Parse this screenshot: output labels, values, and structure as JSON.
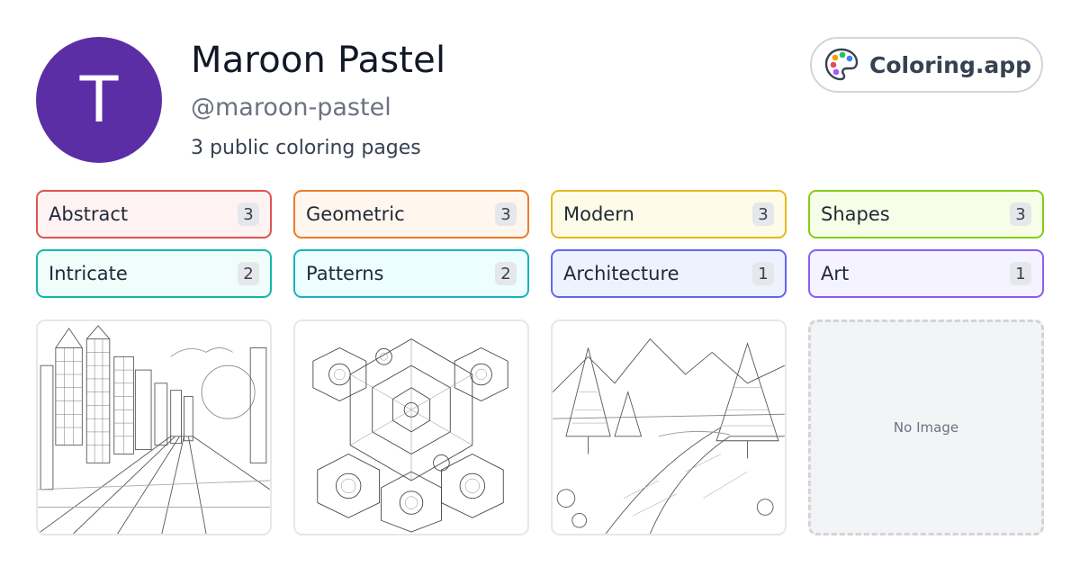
{
  "profile": {
    "avatar_letter": "T",
    "avatar_color": "#5b2ea6",
    "name": "Maroon Pastel",
    "handle": "@maroon-pastel",
    "page_count_text": "3 public coloring pages"
  },
  "brand": {
    "label": "Coloring.app",
    "icon": "palette-icon"
  },
  "tags": [
    {
      "label": "Abstract",
      "count": "3",
      "border": "#e05252",
      "bg": "#fef2f2"
    },
    {
      "label": "Geometric",
      "count": "3",
      "border": "#ea7c2a",
      "bg": "#fff7ed"
    },
    {
      "label": "Modern",
      "count": "3",
      "border": "#e6b820",
      "bg": "#fefce8"
    },
    {
      "label": "Shapes",
      "count": "3",
      "border": "#84cc16",
      "bg": "#f7fee7"
    },
    {
      "label": "Intricate",
      "count": "2",
      "border": "#14b8a6",
      "bg": "#f0fdfa"
    },
    {
      "label": "Patterns",
      "count": "2",
      "border": "#1ab2c0",
      "bg": "#ecfeff"
    },
    {
      "label": "Architecture",
      "count": "1",
      "border": "#6366f1",
      "bg": "#eef2ff"
    },
    {
      "label": "Art",
      "count": "1",
      "border": "#8b5cf6",
      "bg": "#f5f3ff"
    }
  ],
  "gallery": {
    "items": [
      {
        "kind": "cityscape-line-art"
      },
      {
        "kind": "geometric-hexagon-line-art"
      },
      {
        "kind": "landscape-trees-line-art"
      }
    ],
    "empty_label": "No Image"
  }
}
